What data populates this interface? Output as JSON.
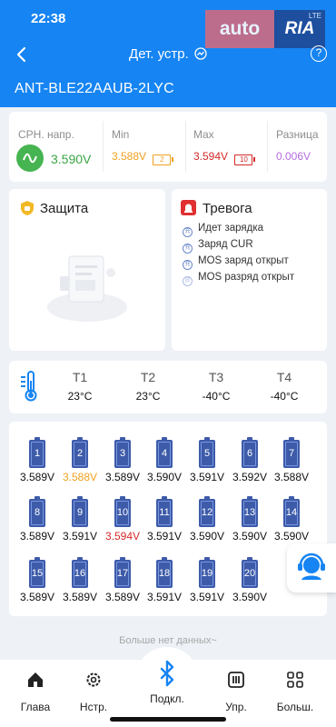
{
  "status_bar": {
    "time": "22:38",
    "network": "LTE"
  },
  "watermark": {
    "auto": "auto",
    "ria": "RIA",
    "domain": ".com"
  },
  "header": {
    "title": "Дет. устр.",
    "device_name": "ANT-BLE22AAUB-2LYC"
  },
  "voltage_summary": {
    "avg_label": "СРН. напр.",
    "avg_value": "3.590V",
    "min_label": "Min",
    "min_value": "3.588V",
    "min_cell": "2",
    "max_label": "Max",
    "max_value": "3.594V",
    "max_cell": "10",
    "diff_label": "Разница",
    "diff_value": "0.006V"
  },
  "protection": {
    "title": "Защита"
  },
  "alarm": {
    "title": "Тревога",
    "items": [
      {
        "badge": "充",
        "label": "Идет зарядка"
      },
      {
        "badge": "充",
        "label": "Заряд CUR"
      },
      {
        "badge": "充",
        "label": "MOS заряд открыт"
      },
      {
        "badge": "放",
        "label": "MOS разряд открыт"
      }
    ]
  },
  "temperatures": [
    {
      "label": "T1",
      "value": "23°C"
    },
    {
      "label": "T2",
      "value": "23°C"
    },
    {
      "label": "T3",
      "value": "-40°C"
    },
    {
      "label": "T4",
      "value": "-40°C"
    }
  ],
  "cells": [
    {
      "n": "1",
      "v": "3.589V"
    },
    {
      "n": "2",
      "v": "3.588V"
    },
    {
      "n": "3",
      "v": "3.589V"
    },
    {
      "n": "4",
      "v": "3.590V"
    },
    {
      "n": "5",
      "v": "3.591V"
    },
    {
      "n": "6",
      "v": "3.592V"
    },
    {
      "n": "7",
      "v": "3.588V"
    },
    {
      "n": "8",
      "v": "3.589V"
    },
    {
      "n": "9",
      "v": "3.591V"
    },
    {
      "n": "10",
      "v": "3.594V"
    },
    {
      "n": "11",
      "v": "3.591V"
    },
    {
      "n": "12",
      "v": "3.590V"
    },
    {
      "n": "13",
      "v": "3.590V"
    },
    {
      "n": "14",
      "v": "3.590V"
    },
    {
      "n": "15",
      "v": "3.589V"
    },
    {
      "n": "16",
      "v": "3.589V"
    },
    {
      "n": "17",
      "v": "3.589V"
    },
    {
      "n": "18",
      "v": "3.591V"
    },
    {
      "n": "19",
      "v": "3.591V"
    },
    {
      "n": "20",
      "v": "3.590V"
    }
  ],
  "no_more_text": "Больше нет данных~",
  "nav": {
    "home": "Глава",
    "settings": "Нстр.",
    "connect": "Подкл.",
    "control": "Упр.",
    "more": "Больш."
  },
  "colors": {
    "primary": "#1684f2",
    "min": "#f0a020",
    "max": "#d42a2a",
    "diff": "#b56de0",
    "avg": "#3aa544",
    "cell": "#3d5ba9"
  },
  "icons": [
    "back-icon",
    "chart-icon",
    "help-icon",
    "sine-wave-icon",
    "shield-icon",
    "alarm-icon",
    "thermometer-icon",
    "battery-icon",
    "support-agent-icon",
    "home-icon",
    "gear-icon",
    "bluetooth-icon",
    "sliders-icon",
    "grid-icon"
  ]
}
